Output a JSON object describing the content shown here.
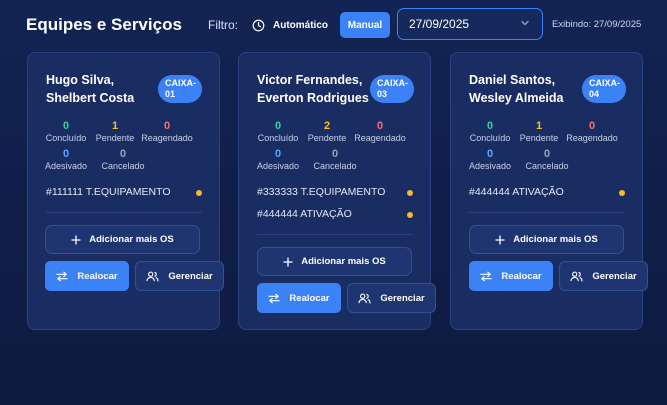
{
  "header": {
    "title": "Equipes e Serviços",
    "filter_label": "Filtro:",
    "auto_label": "Automático",
    "manual_label": "Manual",
    "date_value": "27/09/2025",
    "showing": "Exibindo: 27/09/2025"
  },
  "colors": {
    "accent": "#3b82f6",
    "done": "#34d399",
    "pending": "#fbbf24",
    "rescheduled": "#f87171",
    "adhered": "#60a5fa",
    "cancelled": "#94a3b8",
    "order_dot": "#f5b82e"
  },
  "stat_labels": {
    "concluido": "Concluído",
    "pendente": "Pendente",
    "reagendado": "Reagendado",
    "adesivado": "Adesivado",
    "cancelado": "Cancelado"
  },
  "buttons": {
    "add": "Adicionar mais OS",
    "realocar": "Realocar",
    "gerenciar": "Gerenciar"
  },
  "teams": [
    {
      "name1": "Hugo Silva,",
      "name2": "Shelbert Costa",
      "badge1": "CAIXA-",
      "badge2": "01",
      "concluido": "0",
      "pendente": "1",
      "reagendado": "0",
      "adesivado": "0",
      "cancelado": "0",
      "orders": [
        "#111111 T.EQUIPAMENTO"
      ]
    },
    {
      "name1": "Victor Fernandes,",
      "name2": "Everton Rodrigues",
      "badge1": "CAIXA-",
      "badge2": "03",
      "concluido": "0",
      "pendente": "2",
      "reagendado": "0",
      "adesivado": "0",
      "cancelado": "0",
      "orders": [
        "#333333 T.EQUIPAMENTO",
        "#444444 ATIVAÇÃO"
      ]
    },
    {
      "name1": "Daniel Santos,",
      "name2": "Wesley Almeida",
      "badge1": "CAIXA-",
      "badge2": "04",
      "concluido": "0",
      "pendente": "1",
      "reagendado": "0",
      "adesivado": "0",
      "cancelado": "0",
      "orders": [
        "#444444 ATIVAÇÃO"
      ]
    }
  ]
}
